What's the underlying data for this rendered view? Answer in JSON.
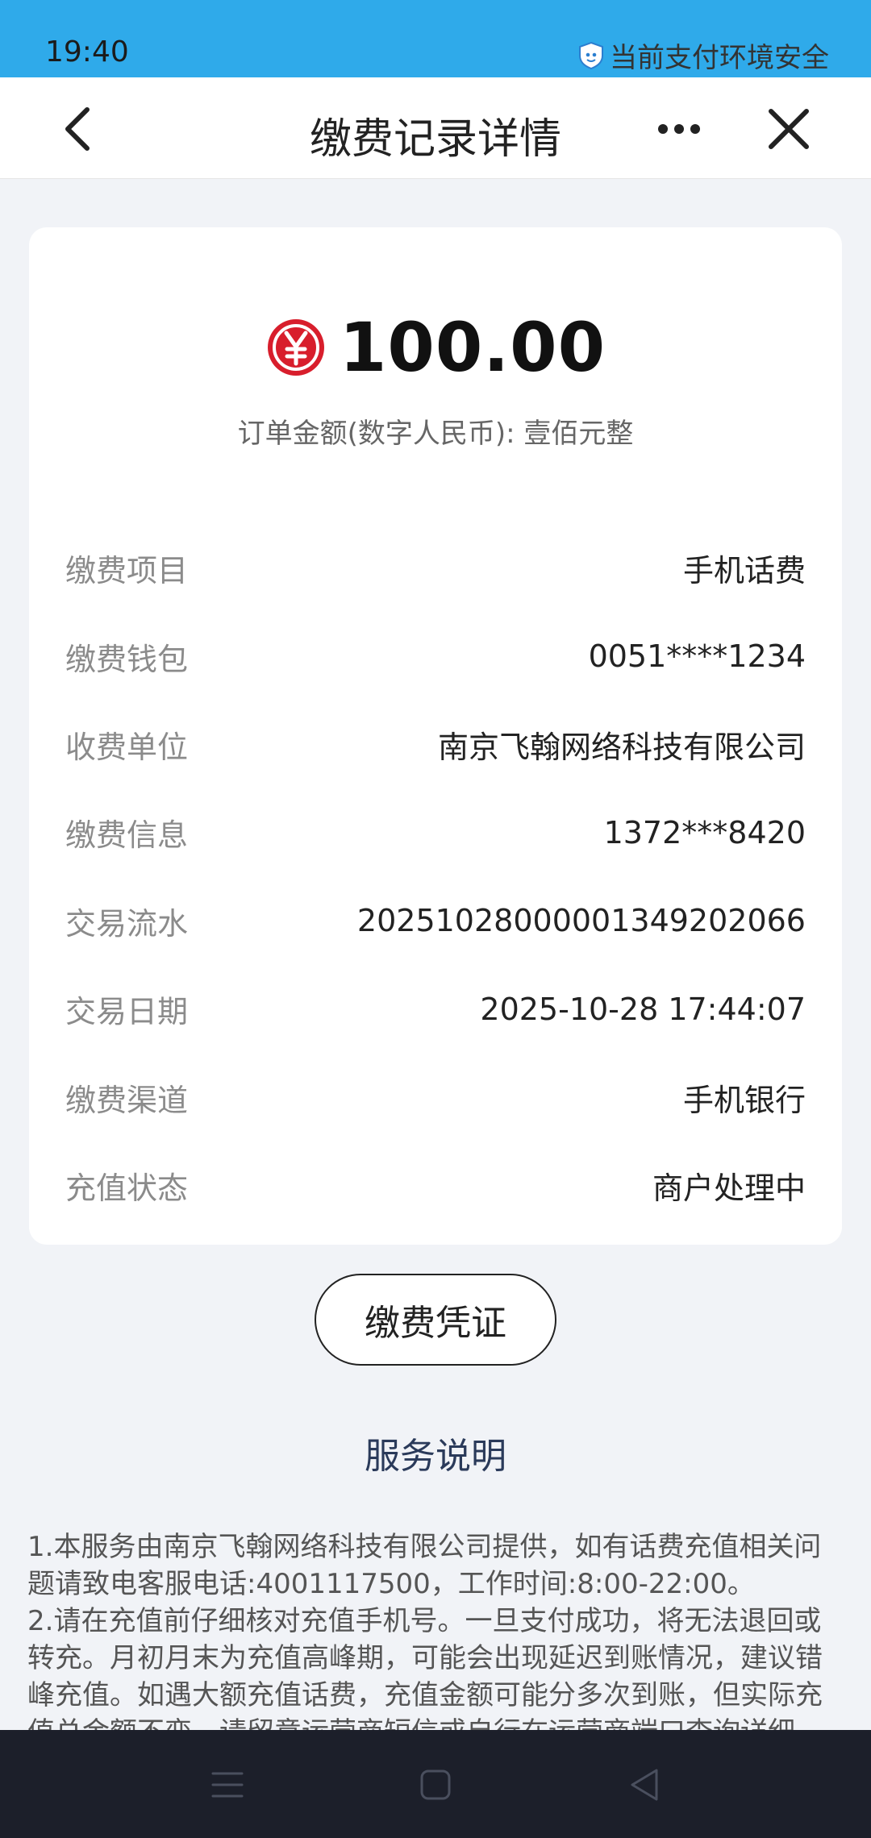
{
  "status_bar": {
    "time": "19:40",
    "security_text": "当前支付环境安全",
    "icon": "shield-icon"
  },
  "nav": {
    "title": "缴费记录详情",
    "back_icon": "chevron-left-icon",
    "more_icon": "more-icon",
    "close_icon": "close-icon"
  },
  "summary": {
    "currency_icon": "digital-rmb-icon",
    "amount": "100.00",
    "caption": "订单金额(数字人民币): 壹佰元整"
  },
  "details": [
    {
      "label": "缴费项目",
      "value": "手机话费"
    },
    {
      "label": "缴费钱包",
      "value": "0051****1234"
    },
    {
      "label": "收费单位",
      "value": "南京飞翰网络科技有限公司"
    },
    {
      "label": "缴费信息",
      "value": "1372***8420"
    },
    {
      "label": "交易流水",
      "value": "2025102800000134920206​6"
    },
    {
      "label": "交易日期",
      "value": "2025-10-28 17:44:07"
    },
    {
      "label": "缴费渠道",
      "value": "手机银行"
    },
    {
      "label": "充值状态",
      "value": "商户处理中"
    }
  ],
  "receipt_button": "缴费凭证",
  "service": {
    "title": "服务说明",
    "notes": [
      "1.本服务由南京飞翰网络科技有限公司提供，如有话费充值相关问题请致电客服电话:4001117500，工作时间:8:00-22:00。",
      "2.请在充值前仔细核对充值手机号。一旦支付成功，将无法退回或转充。月初月末为充值高峰期，可能会出现延迟到账情况，建议错峰充值。如遇大额充值话费，充值金额可能分多次到账，但实际充值总金额不变，请留意运营商短信或自行在运营商端口查询详细"
    ]
  },
  "system_nav": {
    "menu_icon": "menu-icon",
    "home_icon": "home-icon",
    "back_icon": "back-triangle-icon"
  },
  "colors": {
    "status_bar": "#2faaea",
    "page_bg": "#f1f3f7",
    "currency_red": "#d81e2c",
    "system_nav": "#1c1f2a"
  }
}
